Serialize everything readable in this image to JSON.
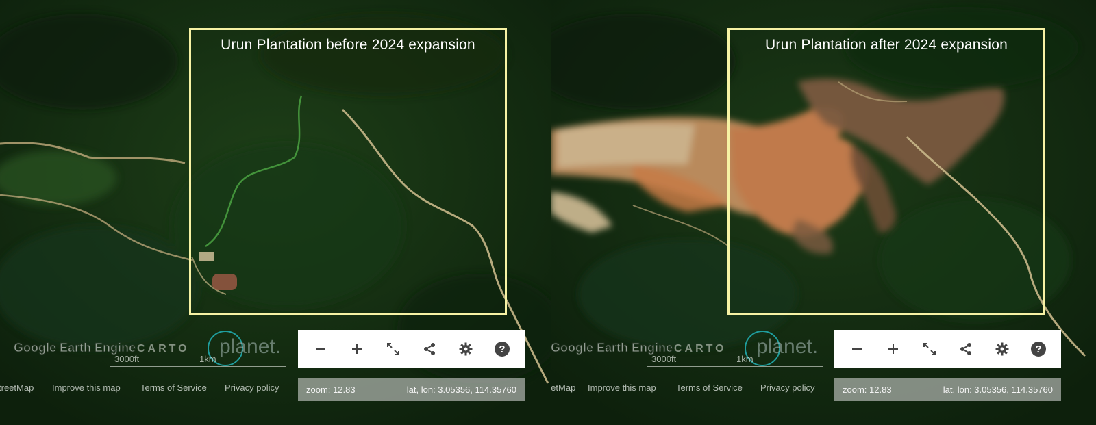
{
  "panels": [
    {
      "title": "Urun Plantation before 2024 expansion",
      "attribution": {
        "osm": "treetMap",
        "improve": "Improve this map",
        "terms": "Terms of Service",
        "privacy": "Privacy policy"
      },
      "brands": {
        "gee": "Google Earth Engine",
        "carto": "CARTO",
        "planet": "planet."
      },
      "scale": {
        "ft": "3000ft",
        "km": "1km"
      },
      "controls": [
        "zoom-out",
        "zoom-in",
        "fullscreen",
        "share",
        "settings",
        "help"
      ],
      "status": {
        "zoom": "zoom: 12.83",
        "latlon": "lat, lon: 3.05356, 114.35760"
      }
    },
    {
      "title": "Urun Plantation after 2024 expansion",
      "attribution": {
        "osm": "treetMap",
        "improve": "Improve this map",
        "terms": "Terms of Service",
        "privacy": "Privacy policy"
      },
      "brands": {
        "gee": "Google Earth Engine",
        "carto": "CARTO",
        "planet": "planet."
      },
      "scale": {
        "ft": "3000ft",
        "km": "1km"
      },
      "controls": [
        "zoom-out",
        "zoom-in",
        "fullscreen",
        "share",
        "settings",
        "help"
      ],
      "status": {
        "zoom": "zoom: 12.83",
        "latlon": "lat, lon: 3.05356, 114.35760"
      }
    }
  ],
  "colors": {
    "forest_dark": "#0f240e",
    "forest": "#1f3d18",
    "river": "#c9b889",
    "clearing": "#b77a4c",
    "aoi_border": "#f6f2a4",
    "planet_ring": "#1f9e9e"
  }
}
